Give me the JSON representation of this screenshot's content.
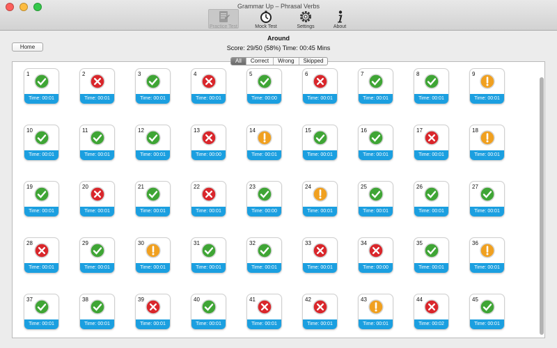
{
  "window": {
    "title": "Grammar Up – Phrasal Verbs"
  },
  "toolbar": {
    "items": [
      {
        "label": "Practice Test",
        "icon": "practice-test-icon",
        "active": true
      },
      {
        "label": "Mock Test",
        "icon": "mock-test-icon",
        "active": false
      },
      {
        "label": "Settings",
        "icon": "settings-icon",
        "active": false
      },
      {
        "label": "About",
        "icon": "about-icon",
        "active": false
      }
    ]
  },
  "header": {
    "home_label": "Home",
    "test_title": "Around",
    "score_line": "Score: 29/50 (58%) Time: 00:45 Mins"
  },
  "filter": {
    "options": [
      "All",
      "Correct",
      "Wrong",
      "Skipped"
    ],
    "selected": "All"
  },
  "colors": {
    "correct": "#3fa535",
    "wrong": "#d9262b",
    "skipped": "#f0a020",
    "time_bar": "#1b9fe0"
  },
  "time_prefix": "Time: ",
  "questions": [
    {
      "num": "1",
      "status": "correct",
      "time": "00:01"
    },
    {
      "num": "2",
      "status": "wrong",
      "time": "00:01"
    },
    {
      "num": "3",
      "status": "correct",
      "time": "00:01"
    },
    {
      "num": "4",
      "status": "wrong",
      "time": "00:01"
    },
    {
      "num": "5",
      "status": "correct",
      "time": "00:00"
    },
    {
      "num": "6",
      "status": "wrong",
      "time": "00:01"
    },
    {
      "num": "7",
      "status": "correct",
      "time": "00:01"
    },
    {
      "num": "8",
      "status": "correct",
      "time": "00:01"
    },
    {
      "num": "9",
      "status": "skipped",
      "time": "00:01"
    },
    {
      "num": "10",
      "status": "correct",
      "time": "00:01"
    },
    {
      "num": "11",
      "status": "correct",
      "time": "00:01"
    },
    {
      "num": "12",
      "status": "correct",
      "time": "00:01"
    },
    {
      "num": "13",
      "status": "wrong",
      "time": "00:00"
    },
    {
      "num": "14",
      "status": "skipped",
      "time": "00:01"
    },
    {
      "num": "15",
      "status": "correct",
      "time": "00:01"
    },
    {
      "num": "16",
      "status": "correct",
      "time": "00:01"
    },
    {
      "num": "17",
      "status": "wrong",
      "time": "00:01"
    },
    {
      "num": "18",
      "status": "skipped",
      "time": "00:01"
    },
    {
      "num": "19",
      "status": "correct",
      "time": "00:01"
    },
    {
      "num": "20",
      "status": "wrong",
      "time": "00:01"
    },
    {
      "num": "21",
      "status": "correct",
      "time": "00:01"
    },
    {
      "num": "22",
      "status": "wrong",
      "time": "00:01"
    },
    {
      "num": "23",
      "status": "correct",
      "time": "00:00"
    },
    {
      "num": "24",
      "status": "skipped",
      "time": "00:01"
    },
    {
      "num": "25",
      "status": "correct",
      "time": "00:01"
    },
    {
      "num": "26",
      "status": "correct",
      "time": "00:01"
    },
    {
      "num": "27",
      "status": "correct",
      "time": "00:01"
    },
    {
      "num": "28",
      "status": "wrong",
      "time": "00:01"
    },
    {
      "num": "29",
      "status": "correct",
      "time": "00:01"
    },
    {
      "num": "30",
      "status": "skipped",
      "time": "00:01"
    },
    {
      "num": "31",
      "status": "correct",
      "time": "00:01"
    },
    {
      "num": "32",
      "status": "correct",
      "time": "00:01"
    },
    {
      "num": "33",
      "status": "wrong",
      "time": "00:01"
    },
    {
      "num": "34",
      "status": "wrong",
      "time": "00:00"
    },
    {
      "num": "35",
      "status": "correct",
      "time": "00:01"
    },
    {
      "num": "36",
      "status": "skipped",
      "time": "00:01"
    },
    {
      "num": "37",
      "status": "correct",
      "time": "00:01"
    },
    {
      "num": "38",
      "status": "correct",
      "time": "00:01"
    },
    {
      "num": "39",
      "status": "wrong",
      "time": "00:01"
    },
    {
      "num": "40",
      "status": "correct",
      "time": "00:01"
    },
    {
      "num": "41",
      "status": "wrong",
      "time": "00:01"
    },
    {
      "num": "42",
      "status": "wrong",
      "time": "00:01"
    },
    {
      "num": "43",
      "status": "skipped",
      "time": "00:01"
    },
    {
      "num": "44",
      "status": "wrong",
      "time": "00:02"
    },
    {
      "num": "45",
      "status": "correct",
      "time": "00:01"
    }
  ]
}
